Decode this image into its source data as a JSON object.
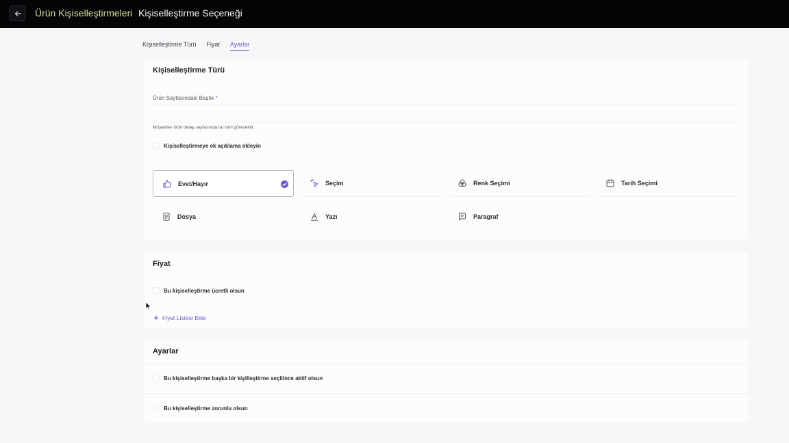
{
  "header": {
    "back_icon": "arrow-left-icon",
    "breadcrumb_parent": "Ürün Kişiselleştirmeleri",
    "breadcrumb_separator": "›",
    "title": "Kişiselleştirme Seçeneği"
  },
  "tabs": [
    {
      "label": "Kişiselleştirme Türü"
    },
    {
      "label": "Fiyat"
    },
    {
      "label": "Ayarlar",
      "active": true
    }
  ],
  "type_section": {
    "title": "Kişiselleştirme Türü",
    "field_label": "Ürün Sayfasındaki Başlık",
    "required_mark": "*",
    "field_value": "",
    "field_hint": "Müşteriler ürün detay sayfasında bu ismi görecektir.",
    "description_checkbox_label": "Kişiselleştirmeye ek açıklama ekleyin",
    "description_checked": false,
    "options": [
      {
        "label": "Evet/Hayır",
        "icon": "thumbs-up-icon",
        "selected": true
      },
      {
        "label": "Seçim",
        "icon": "pointer-click-icon",
        "selected": false
      },
      {
        "label": "Renk Seçimi",
        "icon": "color-circles-icon",
        "selected": false
      },
      {
        "label": "Tarih Seçimi",
        "icon": "calendar-icon",
        "selected": false
      },
      {
        "label": "Dosya",
        "icon": "file-icon",
        "selected": false
      },
      {
        "label": "Yazı",
        "icon": "text-a-icon",
        "selected": false
      },
      {
        "label": "Paragraf",
        "icon": "message-text-icon",
        "selected": false
      }
    ]
  },
  "price_section": {
    "title": "Fiyat",
    "paid_checkbox_label": "Bu kişiselleştirme ücretli olsun",
    "paid_checked": false,
    "add_price_list_label": "Fiyat Listesi Ekle"
  },
  "settings_section": {
    "title": "Ayarlar",
    "conditional_label": "Bu kişiselleştirme başka bir kişilleştirme seçilince aktif olsun",
    "conditional_checked": false,
    "required_label": "Bu kişiselleştirme zorunlu olsun",
    "required_checked": false
  },
  "colors": {
    "accent": "#6a5bd0",
    "topbar_bg": "#050507",
    "breadcrumb_parent": "#d7dc9a",
    "page_bg": "#f7f7f9"
  }
}
